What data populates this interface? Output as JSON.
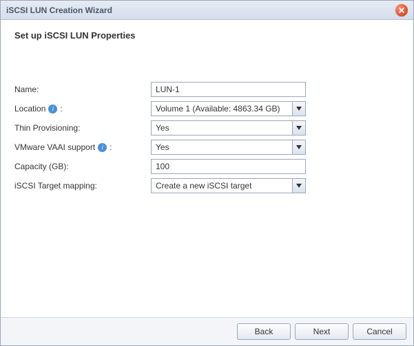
{
  "window": {
    "title": "iSCSI LUN Creation Wizard"
  },
  "heading": "Set up iSCSI LUN Properties",
  "labels": {
    "name": "Name:",
    "location_pre": "Location",
    "location_post": ":",
    "thin_provisioning": "Thin Provisioning:",
    "vmware_pre": "VMware VAAI support",
    "vmware_post": ":",
    "capacity": "Capacity (GB):",
    "target_mapping": "iSCSI Target mapping:"
  },
  "values": {
    "name": "LUN-1",
    "location": "Volume 1 (Available: 4863.34 GB)",
    "thin_provisioning": "Yes",
    "vmware": "Yes",
    "capacity": "100",
    "target_mapping": "Create a new iSCSI target"
  },
  "buttons": {
    "back": "Back",
    "next": "Next",
    "cancel": "Cancel"
  }
}
